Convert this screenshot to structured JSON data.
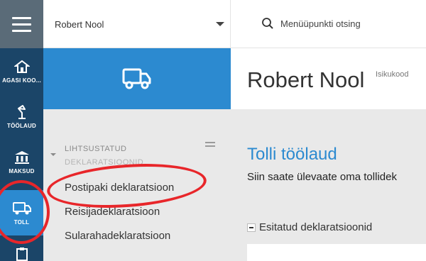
{
  "header": {
    "user_name": "Robert Nool",
    "search_label": "Menüüpunkti otsing"
  },
  "rail": {
    "items": [
      {
        "label": "AGASI KOO...",
        "icon": "house-icon"
      },
      {
        "label": "TÖÖLAUD",
        "icon": "desk-lamp-icon"
      },
      {
        "label": "MAKSUD",
        "icon": "bank-icon"
      },
      {
        "label": "TOLL",
        "icon": "truck-icon",
        "active": true
      },
      {
        "label": "",
        "icon": "clipboard-icon"
      }
    ]
  },
  "sidebar": {
    "section_title_line1": "LIHTSUSTATUD",
    "section_title_line2": "DEKLARATSIOONID",
    "links": [
      "Postipaki deklaratsioon",
      "Reisijadeklaratsioon",
      "Sularahadeklaratsioon"
    ]
  },
  "main": {
    "user_name": "Robert Nool",
    "id_label": "Isikukood",
    "title": "Tolli töölaud",
    "subtitle": "Siin saate ülevaate oma tollidek",
    "subsection": "Esitatud deklaratsioonid"
  },
  "colors": {
    "rail_bg": "#1b4568",
    "accent": "#2c8ad0",
    "annotation": "#e8262a"
  }
}
